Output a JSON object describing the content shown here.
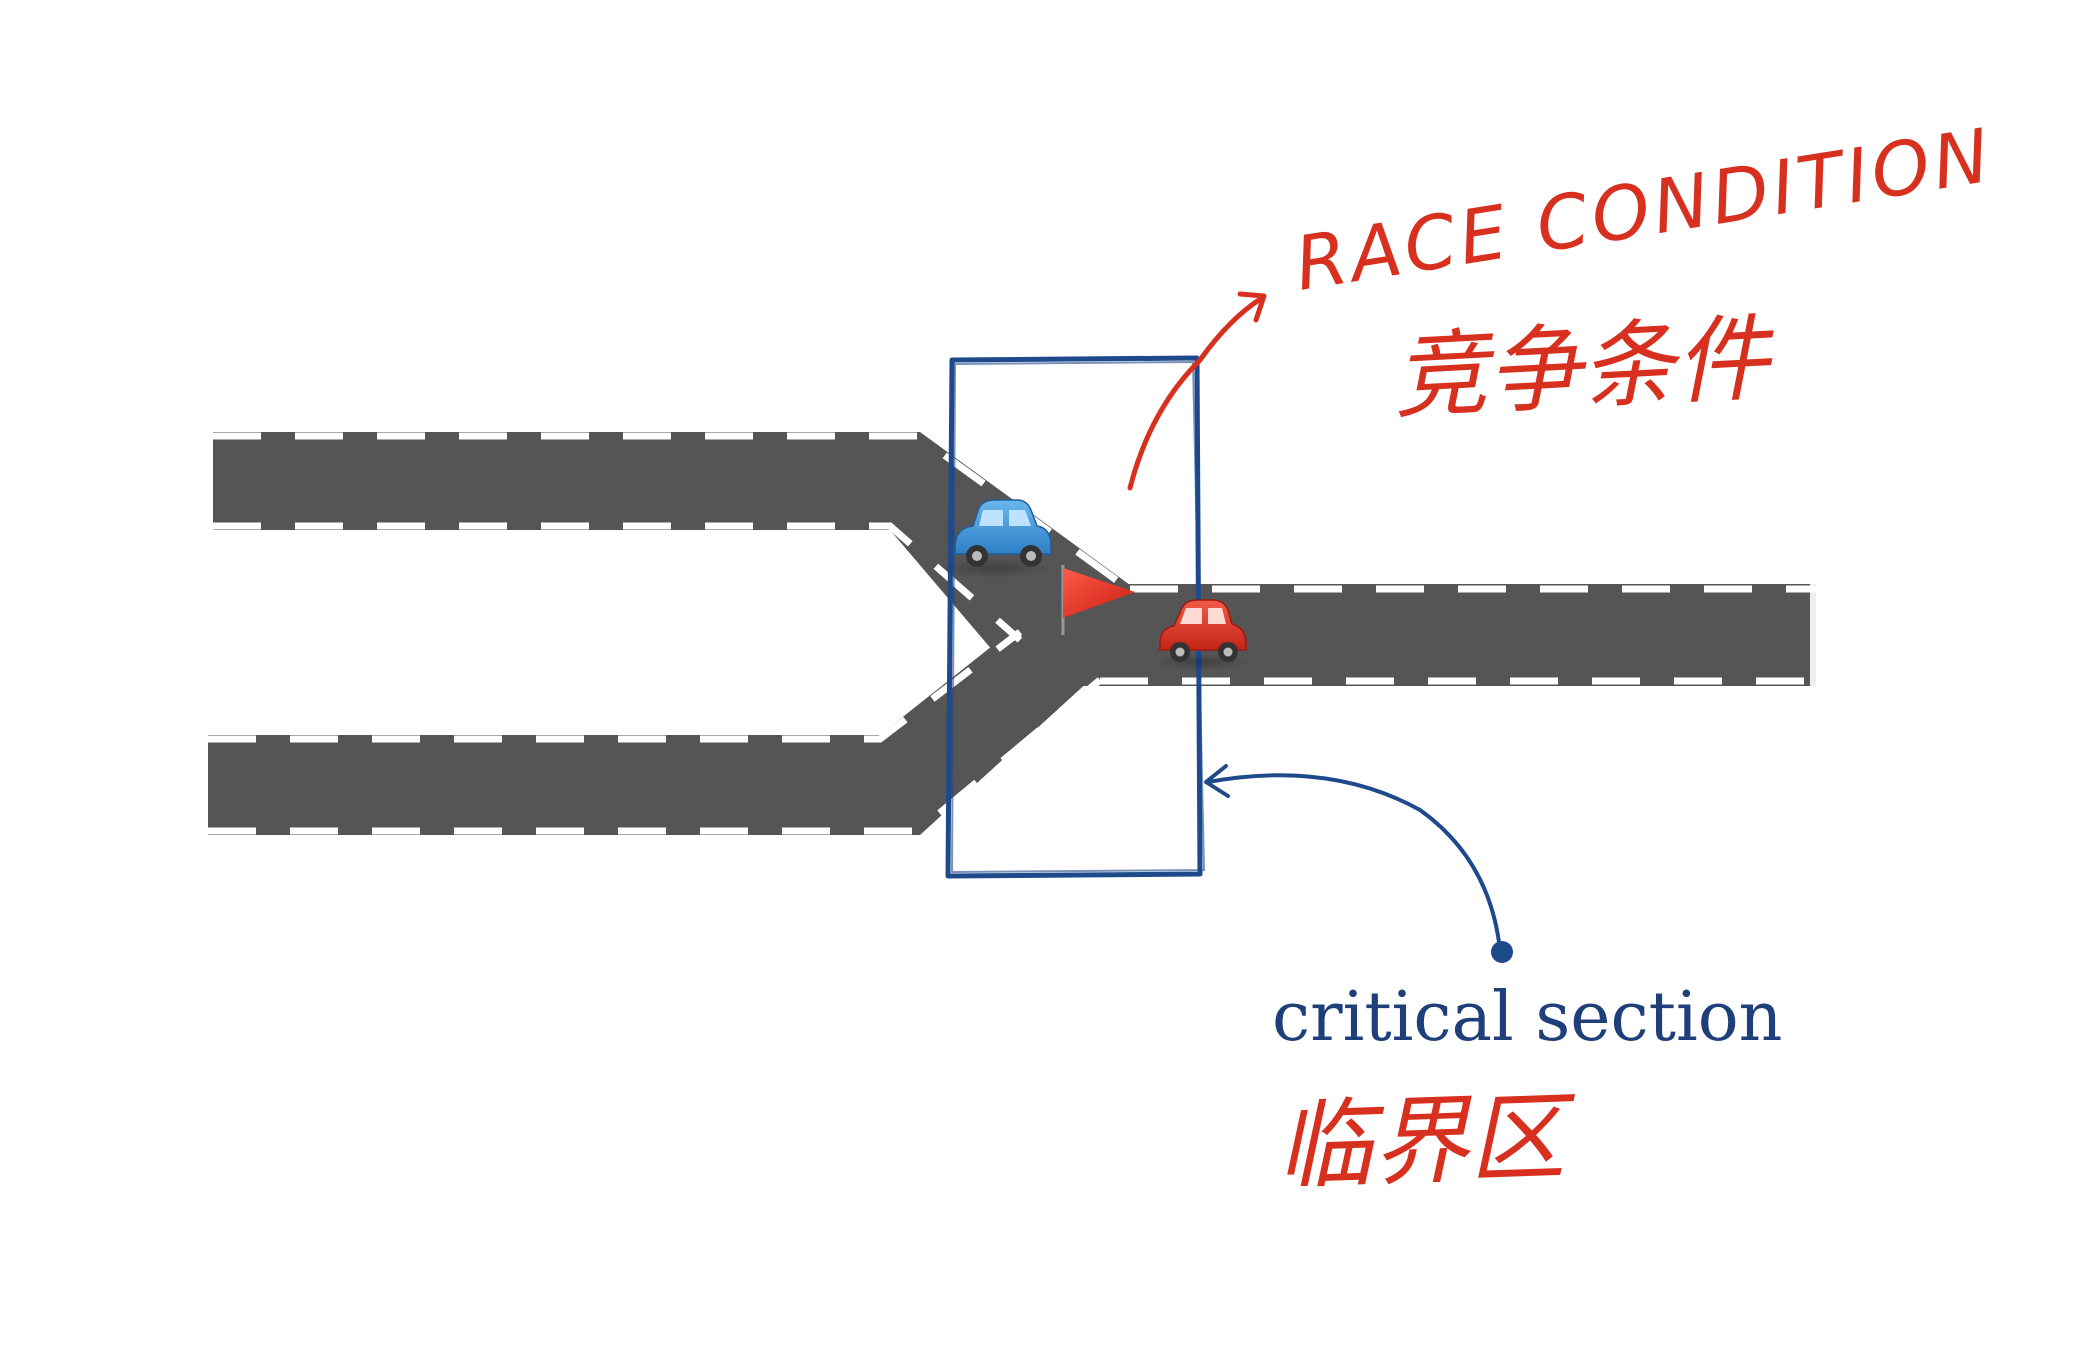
{
  "annotations": {
    "race_condition_en": "RACE CONDITION",
    "race_condition_zh": "竞争条件",
    "critical_section_en": "critical section",
    "critical_section_zh": "临界区"
  },
  "icons": {
    "blue_car": "blue-car-icon",
    "red_car": "red-car-icon",
    "flag": "red-flag-icon"
  },
  "colors": {
    "road": "#555555",
    "lane_marking": "#ffffff",
    "red_ink": "#d8301f",
    "blue_ink": "#1e4a8c",
    "critical_box": "#1e4a8c"
  }
}
